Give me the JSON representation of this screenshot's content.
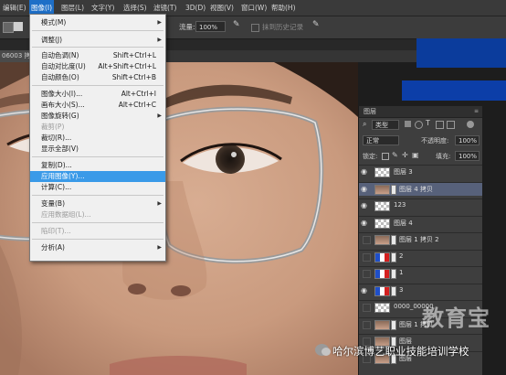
{
  "menubar": {
    "items": [
      {
        "label": "编辑(E)"
      },
      {
        "label": "图像(I)"
      },
      {
        "label": "图层(L)"
      },
      {
        "label": "文字(Y)"
      },
      {
        "label": "选择(S)"
      },
      {
        "label": "滤镜(T)"
      },
      {
        "label": "3D(D)"
      },
      {
        "label": "视图(V)"
      },
      {
        "label": "窗口(W)"
      },
      {
        "label": "帮助(H)"
      }
    ]
  },
  "optionsbar": {
    "flow_label": "流量:",
    "flow_value": "100%",
    "history_label": "抹到历史记录"
  },
  "document": {
    "tab_label": "06003 拷"
  },
  "image_menu": {
    "items": [
      {
        "label": "模式(M)",
        "shortcut": "",
        "submenu": true,
        "disabled": false
      },
      {
        "label": "调整(J)",
        "shortcut": "",
        "submenu": true,
        "disabled": false
      },
      {
        "label": "自动色调(N)",
        "shortcut": "Shift+Ctrl+L",
        "submenu": false,
        "disabled": false
      },
      {
        "label": "自动对比度(U)",
        "shortcut": "Alt+Shift+Ctrl+L",
        "submenu": false,
        "disabled": false
      },
      {
        "label": "自动颜色(O)",
        "shortcut": "Shift+Ctrl+B",
        "submenu": false,
        "disabled": false
      },
      {
        "label": "图像大小(I)...",
        "shortcut": "Alt+Ctrl+I",
        "submenu": false,
        "disabled": false
      },
      {
        "label": "画布大小(S)...",
        "shortcut": "Alt+Ctrl+C",
        "submenu": false,
        "disabled": false
      },
      {
        "label": "图像旋转(G)",
        "shortcut": "",
        "submenu": true,
        "disabled": false
      },
      {
        "label": "裁剪(P)",
        "shortcut": "",
        "submenu": false,
        "disabled": true
      },
      {
        "label": "裁切(R)...",
        "shortcut": "",
        "submenu": false,
        "disabled": false
      },
      {
        "label": "显示全部(V)",
        "shortcut": "",
        "submenu": false,
        "disabled": false
      },
      {
        "label": "复制(D)...",
        "shortcut": "",
        "submenu": false,
        "disabled": false
      },
      {
        "label": "应用图像(Y)...",
        "shortcut": "",
        "submenu": false,
        "disabled": false,
        "highlighted": true
      },
      {
        "label": "计算(C)...",
        "shortcut": "",
        "submenu": false,
        "disabled": false
      },
      {
        "label": "变量(B)",
        "shortcut": "",
        "submenu": true,
        "disabled": false
      },
      {
        "label": "应用数据组(L)...",
        "shortcut": "",
        "submenu": false,
        "disabled": true
      },
      {
        "label": "陷印(T)...",
        "shortcut": "",
        "submenu": false,
        "disabled": true
      },
      {
        "label": "分析(A)",
        "shortcut": "",
        "submenu": true,
        "disabled": false
      }
    ]
  },
  "layers_panel": {
    "title": "图层",
    "filter_label": "类型",
    "blend_mode": "正常",
    "opacity_label": "不透明度:",
    "opacity_value": "100%",
    "lock_label": "锁定:",
    "fill_label": "填充:",
    "fill_value": "100%",
    "layers": [
      {
        "name": "图层 3",
        "visible": true,
        "thumb": "checker",
        "selected": false
      },
      {
        "name": "图层 4 拷贝",
        "visible": true,
        "thumb": "face",
        "selected": true
      },
      {
        "name": "123",
        "visible": true,
        "thumb": "checker",
        "selected": false
      },
      {
        "name": "图层 4",
        "visible": true,
        "thumb": "checker",
        "selected": false
      },
      {
        "name": "图层 1 拷贝 2",
        "visible": false,
        "thumb": "face",
        "selected": false
      },
      {
        "name": "2",
        "visible": false,
        "thumb": "flag",
        "selected": false
      },
      {
        "name": "1",
        "visible": false,
        "thumb": "flag",
        "selected": false
      },
      {
        "name": "3",
        "visible": true,
        "thumb": "flag",
        "selected": false
      },
      {
        "name": "0000_00000",
        "visible": false,
        "thumb": "checker",
        "selected": false
      },
      {
        "name": "图层 1 拷贝",
        "visible": false,
        "thumb": "face",
        "selected": false
      },
      {
        "name": "图层",
        "visible": false,
        "thumb": "face",
        "selected": false
      },
      {
        "name": "图层",
        "visible": false,
        "thumb": "face",
        "selected": false
      }
    ]
  },
  "watermark": {
    "logo": "教育宝",
    "text": "哈尔滨博艺职业技能培训学校"
  }
}
